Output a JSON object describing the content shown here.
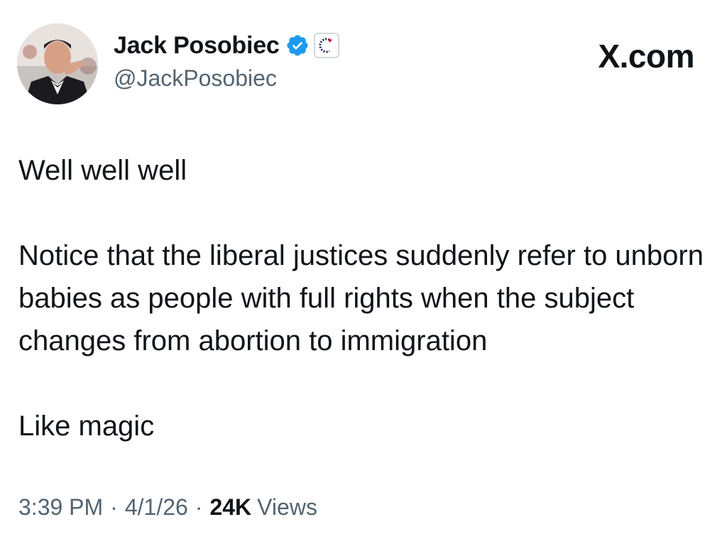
{
  "header": {
    "display_name": "Jack Posobiec",
    "handle": "@JackPosobiec",
    "site_label": "X.com",
    "verified_icon": "verified-badge-icon",
    "affiliate_icon": "affiliate-badge-icon"
  },
  "tweet": {
    "paragraphs": [
      "Well well well",
      "Notice that the liberal justices suddenly refer to unborn babies as people with full rights when the subject changes from abortion to immigration",
      "Like magic"
    ]
  },
  "meta": {
    "time": "3:39 PM",
    "separator": "·",
    "date": "4/1/26",
    "views_count": "24K",
    "views_label": "Views"
  },
  "colors": {
    "text": "#0f1419",
    "secondary": "#536471",
    "verified_blue": "#1d9bf0",
    "background": "#ffffff"
  }
}
